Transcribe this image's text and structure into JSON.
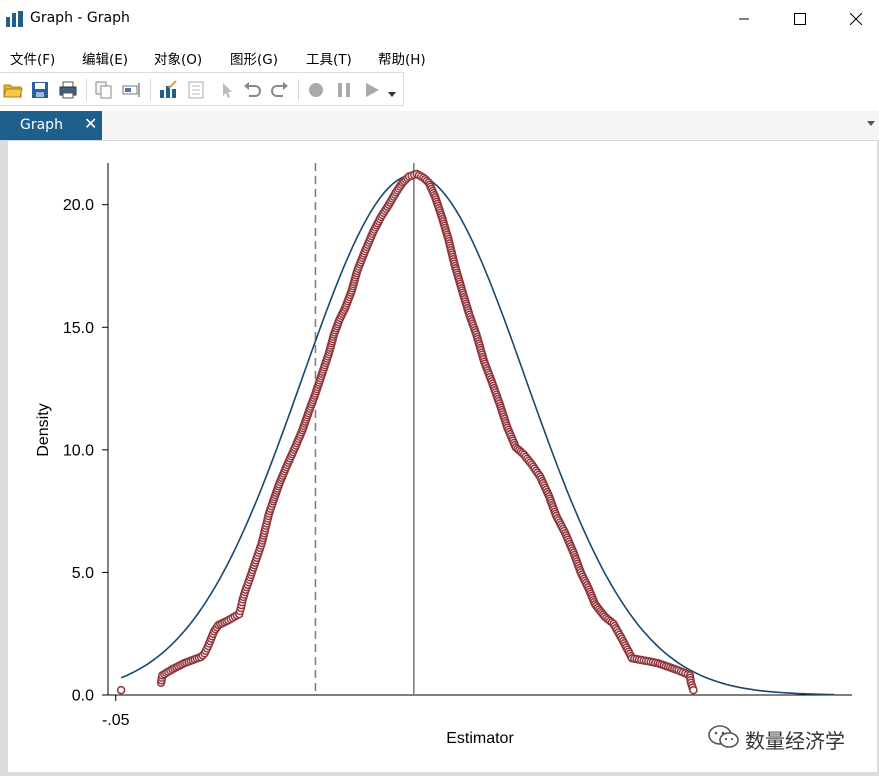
{
  "window": {
    "title": "Graph - Graph",
    "minimize_icon": "minimize-icon",
    "maximize_icon": "maximize-icon",
    "close_icon": "close-icon"
  },
  "menu": [
    {
      "label": "文件(F)"
    },
    {
      "label": "编辑(E)"
    },
    {
      "label": "对象(O)"
    },
    {
      "label": "图形(G)"
    },
    {
      "label": "工具(T)"
    },
    {
      "label": "帮助(H)"
    }
  ],
  "toolbar": {
    "icons": [
      "open-icon",
      "save-icon",
      "print-icon",
      "copy-icon",
      "rename-icon",
      "graph-editor-icon",
      "properties-icon",
      "pointer-icon",
      "undo-icon",
      "redo-icon",
      "record-icon",
      "pause-icon",
      "play-icon",
      "dropdown-icon"
    ]
  },
  "tab": {
    "label": "Graph",
    "close": "✕"
  },
  "colors": {
    "tab_bg": "#1f5f8b",
    "kernel_line": "#1a476f",
    "markers": "#90353b",
    "reference_lines": "#808080"
  },
  "chart_data": {
    "type": "scatter",
    "title": "",
    "xlabel": "Estimator",
    "ylabel": "Density",
    "xlim": [
      -0.0513,
      0.0735
    ],
    "ylim": [
      0,
      21.7
    ],
    "x_ticks": [
      {
        "value": -0.05,
        "label": "-.05"
      }
    ],
    "y_ticks": [
      {
        "value": 0,
        "label": "0.0"
      },
      {
        "value": 5,
        "label": "5.0"
      },
      {
        "value": 10,
        "label": "10.0"
      },
      {
        "value": 15,
        "label": "15.0"
      },
      {
        "value": 20,
        "label": "20.0"
      }
    ],
    "grid": false,
    "legend": "none",
    "reference_lines": [
      {
        "x": -0.0165,
        "style": "dashed"
      },
      {
        "x": 0.0,
        "style": "solid"
      }
    ],
    "series": [
      {
        "kind": "line",
        "description": "normal density curve",
        "mean": 0.0,
        "sd": 0.0188,
        "x_range": [
          -0.0491,
          0.0705
        ]
      },
      {
        "kind": "markers",
        "description": "kernel density of estimator",
        "points": [
          [
            -0.0491,
            0.2
          ],
          [
            -0.0424,
            0.5
          ],
          [
            -0.0422,
            0.8
          ],
          [
            -0.0405,
            1.05
          ],
          [
            -0.0385,
            1.3
          ],
          [
            -0.0357,
            1.55
          ],
          [
            -0.0351,
            1.7
          ],
          [
            -0.0345,
            2.0
          ],
          [
            -0.034,
            2.3
          ],
          [
            -0.0335,
            2.6
          ],
          [
            -0.0328,
            2.85
          ],
          [
            -0.0311,
            3.05
          ],
          [
            -0.0293,
            3.3
          ],
          [
            -0.029,
            3.55
          ],
          [
            -0.0287,
            3.9
          ],
          [
            -0.0282,
            4.3
          ],
          [
            -0.0276,
            4.7
          ],
          [
            -0.0269,
            5.2
          ],
          [
            -0.0262,
            5.7
          ],
          [
            -0.0255,
            6.2
          ],
          [
            -0.0249,
            6.8
          ],
          [
            -0.0243,
            7.4
          ],
          [
            -0.0236,
            7.9
          ],
          [
            -0.0226,
            8.6
          ],
          [
            -0.0214,
            9.3
          ],
          [
            -0.0201,
            10.0
          ],
          [
            -0.0187,
            10.8
          ],
          [
            -0.0177,
            11.5
          ],
          [
            -0.0165,
            12.3
          ],
          [
            -0.0154,
            13.1
          ],
          [
            -0.0143,
            13.9
          ],
          [
            -0.0134,
            14.7
          ],
          [
            -0.0125,
            15.3
          ],
          [
            -0.0115,
            15.8
          ],
          [
            -0.0104,
            16.5
          ],
          [
            -0.0095,
            17.3
          ],
          [
            -0.0082,
            18.1
          ],
          [
            -0.0068,
            18.9
          ],
          [
            -0.0055,
            19.5
          ],
          [
            -0.0042,
            20.0
          ],
          [
            -0.003,
            20.5
          ],
          [
            -0.0019,
            20.9
          ],
          [
            -0.0008,
            21.15
          ],
          [
            0.0005,
            21.25
          ],
          [
            0.0016,
            21.1
          ],
          [
            0.0025,
            20.9
          ],
          [
            0.0036,
            20.3
          ],
          [
            0.0047,
            19.5
          ],
          [
            0.0058,
            18.6
          ],
          [
            0.0069,
            17.5
          ],
          [
            0.0081,
            16.5
          ],
          [
            0.0092,
            15.6
          ],
          [
            0.0105,
            14.7
          ],
          [
            0.0118,
            13.6
          ],
          [
            0.0132,
            12.7
          ],
          [
            0.0145,
            11.8
          ],
          [
            0.0157,
            10.9
          ],
          [
            0.0171,
            10.1
          ],
          [
            0.0185,
            9.8
          ],
          [
            0.0198,
            9.4
          ],
          [
            0.0212,
            8.9
          ],
          [
            0.0227,
            8.1
          ],
          [
            0.0239,
            7.3
          ],
          [
            0.0254,
            6.6
          ],
          [
            0.0268,
            5.8
          ],
          [
            0.028,
            5.0
          ],
          [
            0.0294,
            4.3
          ],
          [
            0.0304,
            3.7
          ],
          [
            0.032,
            3.2
          ],
          [
            0.0335,
            2.9
          ],
          [
            0.0351,
            2.2
          ],
          [
            0.0366,
            1.5
          ],
          [
            0.0409,
            1.3
          ],
          [
            0.0444,
            1.0
          ],
          [
            0.0463,
            0.8
          ],
          [
            0.0465,
            0.5
          ],
          [
            0.0469,
            0.2
          ]
        ]
      }
    ]
  },
  "watermark": {
    "text": "数量经济学",
    "icon": "wechat-icon"
  }
}
